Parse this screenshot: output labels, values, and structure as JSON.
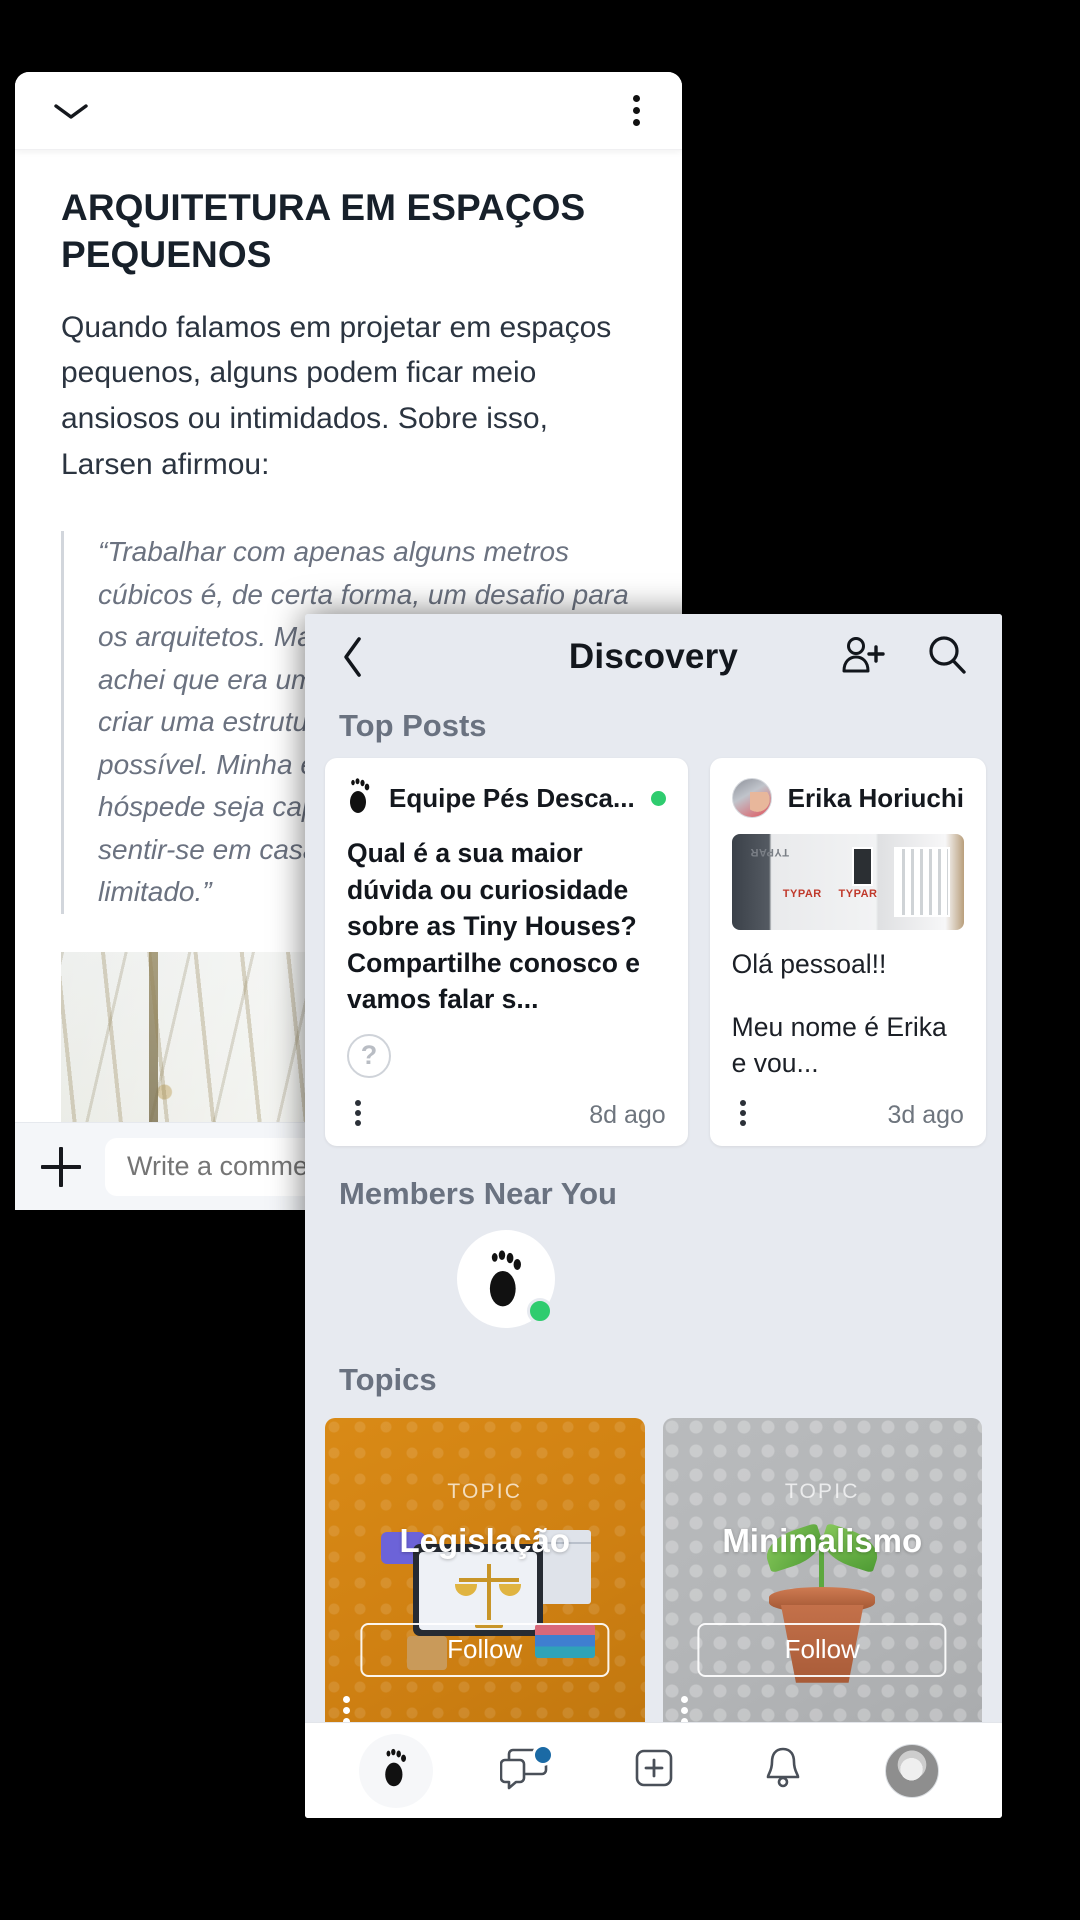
{
  "article": {
    "topbar": {
      "collapse_icon": "chevron-down-icon",
      "menu_icon": "kebab-menu-icon"
    },
    "title": "ARQUITETURA EM ESPAÇOS PEQUENOS",
    "body": "Quando falamos em projetar em espaços pequenos, alguns podem ficar meio ansiosos ou intimidados. Sobre isso, Larsen afirmou:",
    "quote": "“Trabalhar com apenas alguns metros cúbicos é, de certa forma, um desafio para os arquitetos. Mas, ao mesmo tempo, achei que era uma fonte de inspiração criar uma estrutura muito compacta, mas possível. Minha esperança é que o hóspede seja capaz de fazer dela o seu e sentir-se em casa, mesmo que por tempo limitado.”",
    "comment": {
      "add_icon": "plus-icon",
      "placeholder": "Write a comment"
    }
  },
  "discovery": {
    "header": {
      "back_icon": "chevron-left-icon",
      "title": "Discovery",
      "add_member_icon": "add-person-icon",
      "search_icon": "search-icon"
    },
    "sections": {
      "top_posts": "Top Posts",
      "members_near_you": "Members Near You",
      "topics": "Topics"
    },
    "posts": [
      {
        "author": "Equipe Pés Desca...",
        "online": true,
        "text": "Qual é a sua maior dúvida ou curiosidade sobre as Tiny Houses? Compartilhe conosco e vamos falar s...",
        "poll_icon": "question-circle-icon",
        "menu_icon": "kebab-menu-icon",
        "time": "8d ago"
      },
      {
        "author": "Erika Horiuchi",
        "online": false,
        "thumb_labels": [
          "TYPAR",
          "TYPAR",
          "TYPAR"
        ],
        "text_line1": "Olá pessoal!!",
        "text_line2": "Meu nome é Erika e vou...",
        "menu_icon": "kebab-menu-icon",
        "time": "3d ago"
      }
    ],
    "members": [
      {
        "name": "member-avatar-1",
        "online": false
      },
      {
        "name": "member-avatar-2-footprint",
        "online": true
      },
      {
        "name": "member-avatar-3",
        "online": false
      },
      {
        "name": "member-avatar-4",
        "online": false
      }
    ],
    "topics": [
      {
        "kicker": "TOPIC",
        "name": "Legislação",
        "follow_label": "Follow",
        "accent": "#f0a21a",
        "menu_icon": "kebab-menu-icon"
      },
      {
        "kicker": "TOPIC",
        "name": "Minimalismo",
        "follow_label": "Follow",
        "accent": "#17a6bf",
        "menu_icon": "kebab-menu-icon"
      }
    ],
    "bottom_nav": [
      {
        "icon": "footprint-icon",
        "active": true,
        "badge": false
      },
      {
        "icon": "chat-bubbles-icon",
        "active": false,
        "badge": true
      },
      {
        "icon": "plus-square-icon",
        "active": false,
        "badge": false
      },
      {
        "icon": "bell-icon",
        "active": false,
        "badge": false
      },
      {
        "icon": "profile-avatar-icon",
        "active": false,
        "badge": false
      }
    ]
  },
  "colors": {
    "online_green": "#2fcc6f",
    "badge_blue": "#1b6aa5",
    "panel_bg": "#e7eaf0"
  }
}
